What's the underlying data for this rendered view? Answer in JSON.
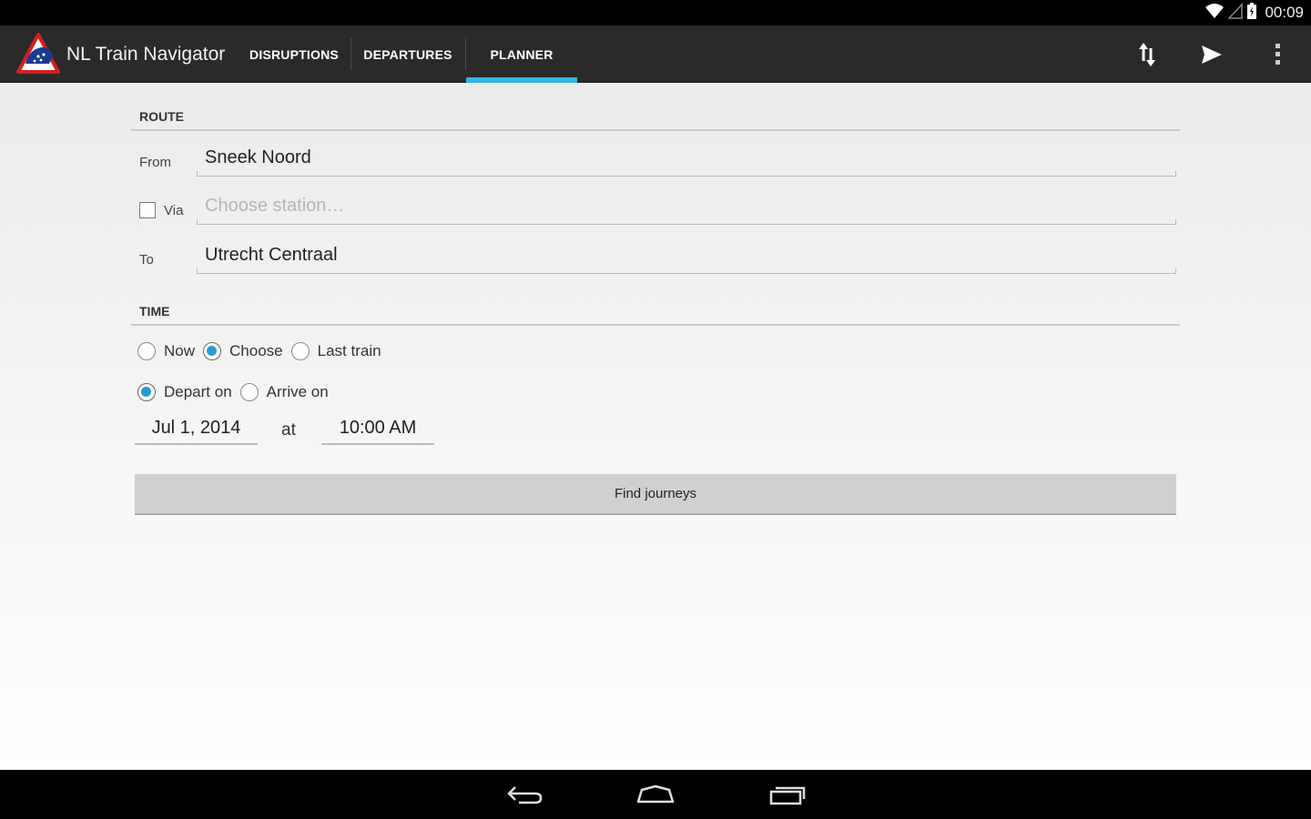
{
  "status_bar": {
    "time": "00:09"
  },
  "app": {
    "title": "NL Train Navigator"
  },
  "tabs": [
    {
      "label": "DISRUPTIONS",
      "active": false
    },
    {
      "label": "DEPARTURES",
      "active": false
    },
    {
      "label": "PLANNER",
      "active": true
    }
  ],
  "action_icons": [
    "swap-direction-icon",
    "send-icon",
    "overflow-menu-icon"
  ],
  "route": {
    "header": "ROUTE",
    "from_label": "From",
    "from_value": "Sneek Noord",
    "via_label": "Via",
    "via_checked": false,
    "via_placeholder": "Choose station…",
    "to_label": "To",
    "to_value": "Utrecht Centraal"
  },
  "time": {
    "header": "TIME",
    "mode_options": [
      {
        "label": "Now",
        "checked": false
      },
      {
        "label": "Choose",
        "checked": true
      },
      {
        "label": "Last train",
        "checked": false
      }
    ],
    "direction_options": [
      {
        "label": "Depart on",
        "checked": true
      },
      {
        "label": "Arrive on",
        "checked": false
      }
    ],
    "date": "Jul 1, 2014",
    "at_label": "at",
    "time_value": "10:00 AM"
  },
  "find_button": "Find journeys",
  "colors": {
    "accent": "#33b5e5",
    "radio": "#2a9bd1",
    "action_bar": "#2a2a2a"
  }
}
